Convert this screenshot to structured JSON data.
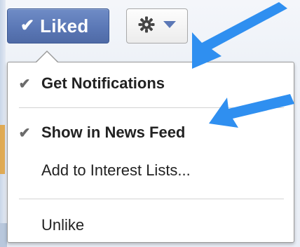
{
  "toolbar": {
    "liked_label": "Liked",
    "liked_check": "✔"
  },
  "menu": {
    "items": [
      {
        "label": "Get Notifications",
        "checked": true,
        "check_glyph": "✔",
        "bold": true
      },
      {
        "label": "Show in News Feed",
        "checked": true,
        "check_glyph": "✔",
        "bold": true
      },
      {
        "label": "Add to Interest Lists...",
        "checked": false,
        "check_glyph": "",
        "bold": false
      },
      {
        "label": "Unlike",
        "checked": false,
        "check_glyph": "",
        "bold": false
      }
    ]
  },
  "colors": {
    "liked_button": "#5b78b6",
    "annotation_arrow": "#2f8ff0",
    "gear_icon": "#444444",
    "chevron_icon": "#5b78b6"
  },
  "icons": {
    "settings": "gear-icon",
    "dropdown": "chevron-down-icon",
    "check": "check-icon"
  }
}
